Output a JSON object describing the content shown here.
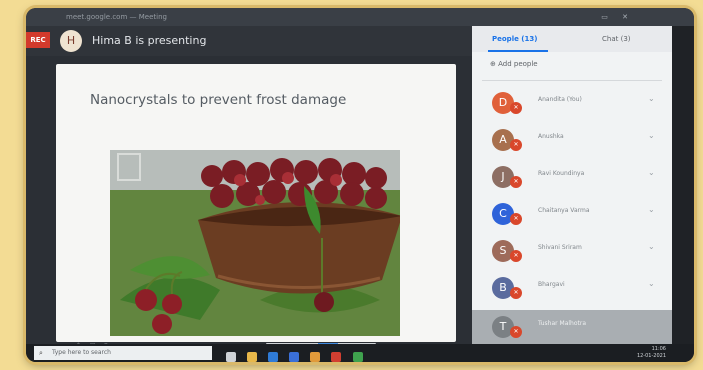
{
  "browser": {
    "tab_text": "meet.google.com — Meeting"
  },
  "meeting": {
    "rec_label": "REC",
    "presenter_initial": "H",
    "presenting_text": "Hima B is presenting"
  },
  "slide": {
    "title": "Nanocrystals to prevent frost damage"
  },
  "side_panel": {
    "people_tab": "People (13)",
    "chat_tab": "Chat (3)",
    "add_people": "Add people",
    "participants": [
      {
        "initial": "D",
        "name": "Anandita (You)",
        "color": "#e0603a"
      },
      {
        "initial": "A",
        "name": "Anushka",
        "color": "#a8704e"
      },
      {
        "initial": "J",
        "name": "Ravi Koundinya",
        "color": "#8d6e63"
      },
      {
        "initial": "C",
        "name": "Chaitanya Varma",
        "color": "#2f63d9"
      },
      {
        "initial": "S",
        "name": "Shivani Sriram",
        "color": "#9e6b5a"
      },
      {
        "initial": "B",
        "name": "Bhargavi",
        "color": "#5a6b9e"
      }
    ],
    "self_initial": "T",
    "self_name": "Tushar Malhotra"
  },
  "taskbar": {
    "search_placeholder": "Type here to search",
    "time": "11:06",
    "date": "12-01-2021"
  }
}
